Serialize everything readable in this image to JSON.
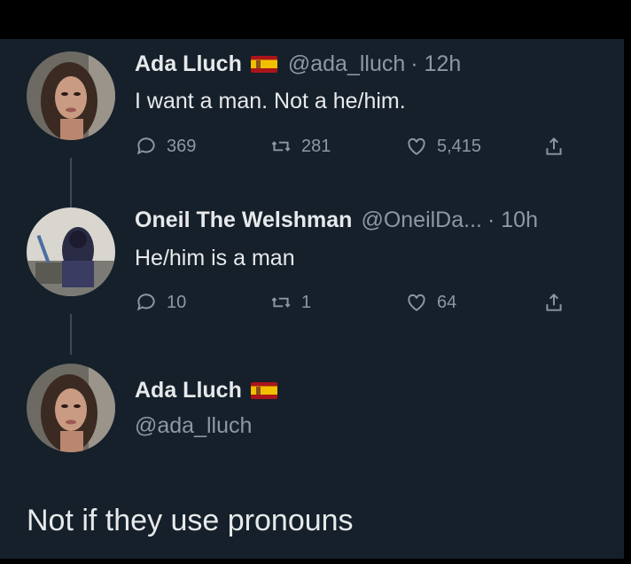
{
  "tweets": [
    {
      "name": "Ada Lluch",
      "handle": "@ada_lluch",
      "time": "· 12h",
      "text": "I want a man. Not a he/him.",
      "replies": "369",
      "retweets": "281",
      "likes": "5,415",
      "has_flag": true
    },
    {
      "name": "Oneil The Welshman",
      "handle": "@OneilDa...",
      "time": "· 10h",
      "text": "He/him is a man",
      "replies": "10",
      "retweets": "1",
      "likes": "64",
      "has_flag": false
    }
  ],
  "reply": {
    "name": "Ada Lluch",
    "handle": "@ada_lluch",
    "text": "Not if they use pronouns"
  },
  "icons": {
    "reply": "speech-bubble-icon",
    "retweet": "retweet-icon",
    "like": "heart-icon",
    "share": "share-icon",
    "flag": "spain-flag-icon"
  },
  "colors": {
    "background": "#15202b",
    "text": "#e7e9ea",
    "muted": "#8b98a5"
  }
}
